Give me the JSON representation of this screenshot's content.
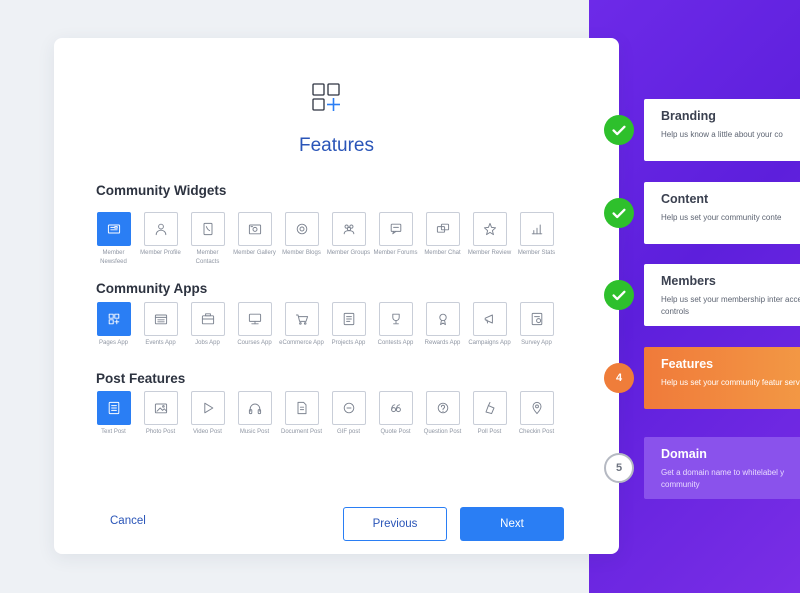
{
  "colors": {
    "accent": "#2a7ef4",
    "title": "#2a55b8",
    "panel": "#6d2ae8",
    "done": "#2ec02c",
    "current": "#ef7d3a"
  },
  "header": {
    "icon": "grid-add-icon",
    "title": "Features"
  },
  "sections": [
    {
      "title": "Community Widgets",
      "items": [
        {
          "label": "Member Newsfeed",
          "icon": "newsfeed-icon",
          "selected": true
        },
        {
          "label": "Member Profile",
          "icon": "profile-icon",
          "selected": false
        },
        {
          "label": "Member Contacts",
          "icon": "contacts-icon",
          "selected": false
        },
        {
          "label": "Member Gallery",
          "icon": "gallery-icon",
          "selected": false
        },
        {
          "label": "Member Blogs",
          "icon": "blogs-icon",
          "selected": false
        },
        {
          "label": "Member Groups",
          "icon": "groups-icon",
          "selected": false
        },
        {
          "label": "Member Forums",
          "icon": "forums-icon",
          "selected": false
        },
        {
          "label": "Member Chat",
          "icon": "chat-icon",
          "selected": false
        },
        {
          "label": "Member Review",
          "icon": "review-icon",
          "selected": false
        },
        {
          "label": "Member Stats",
          "icon": "stats-icon",
          "selected": false
        }
      ]
    },
    {
      "title": "Community Apps",
      "items": [
        {
          "label": "Pages App",
          "icon": "pages-icon",
          "selected": true
        },
        {
          "label": "Events App",
          "icon": "events-icon",
          "selected": false
        },
        {
          "label": "Jobs App",
          "icon": "jobs-icon",
          "selected": false
        },
        {
          "label": "Courses App",
          "icon": "courses-icon",
          "selected": false
        },
        {
          "label": "eCommerce App",
          "icon": "cart-icon",
          "selected": false
        },
        {
          "label": "Projects App",
          "icon": "projects-icon",
          "selected": false
        },
        {
          "label": "Contests App",
          "icon": "trophy-icon",
          "selected": false
        },
        {
          "label": "Rewards App",
          "icon": "medal-icon",
          "selected": false
        },
        {
          "label": "Campaigns App",
          "icon": "megaphone-icon",
          "selected": false
        },
        {
          "label": "Survey App",
          "icon": "survey-icon",
          "selected": false
        }
      ]
    },
    {
      "title": "Post Features",
      "items": [
        {
          "label": "Text Post",
          "icon": "text-icon",
          "selected": true
        },
        {
          "label": "Photo Post",
          "icon": "photo-icon",
          "selected": false
        },
        {
          "label": "Video Post",
          "icon": "play-icon",
          "selected": false
        },
        {
          "label": "Music Post",
          "icon": "headphones-icon",
          "selected": false
        },
        {
          "label": "Document Post",
          "icon": "document-icon",
          "selected": false
        },
        {
          "label": "GIF post",
          "icon": "gif-icon",
          "selected": false
        },
        {
          "label": "Quote Post",
          "icon": "quote-icon",
          "selected": false
        },
        {
          "label": "Question Post",
          "icon": "question-icon",
          "selected": false
        },
        {
          "label": "Poll Post",
          "icon": "poll-icon",
          "selected": false
        },
        {
          "label": "Checkin Post",
          "icon": "location-pin-icon",
          "selected": false
        }
      ]
    }
  ],
  "buttons": {
    "cancel": "Cancel",
    "previous": "Previous",
    "next": "Next"
  },
  "steps": [
    {
      "badge": "",
      "status": "done",
      "title": "Branding",
      "desc": "Help us know a little about your co"
    },
    {
      "badge": "",
      "status": "done",
      "title": "Content",
      "desc": "Help us set your community conte"
    },
    {
      "badge": "",
      "status": "done",
      "title": "Members",
      "desc": "Help us set your membership inter access controls"
    },
    {
      "badge": "4",
      "status": "current",
      "title": "Features",
      "desc": "Help us set your community featur services"
    },
    {
      "badge": "5",
      "status": "pending",
      "title": "Domain",
      "desc": "Get a domain name to whitelabel y community"
    }
  ]
}
